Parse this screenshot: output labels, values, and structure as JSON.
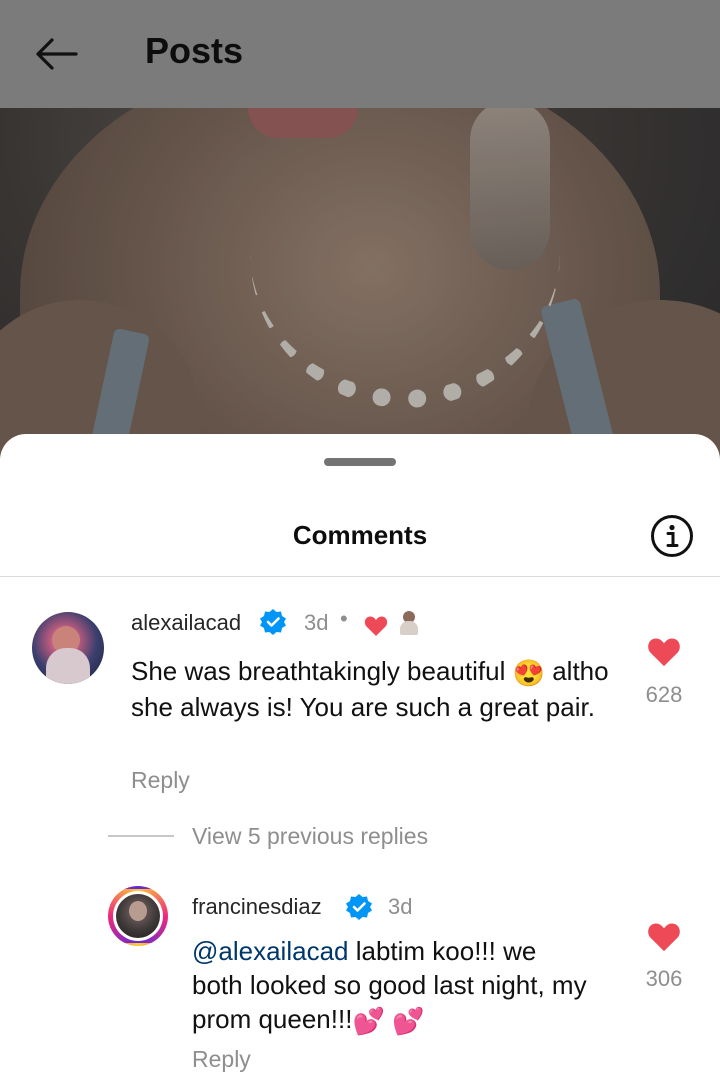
{
  "header": {
    "title": "Posts",
    "back_icon": "arrow-left-icon"
  },
  "sheet": {
    "title": "Comments",
    "info_icon": "info-icon"
  },
  "comments": [
    {
      "username": "alexailacad",
      "verified": true,
      "time": "3d",
      "text": "She was breathtakingly beautiful",
      "text_emoji": "😍",
      "text_rest": "altho she always is! You are such a great pair.",
      "reply_label": "Reply",
      "likes": "628",
      "liked": true,
      "author_liked": true
    }
  ],
  "view_replies_label": "View 5 previous replies",
  "replies": [
    {
      "username": "francinesdiaz",
      "verified": true,
      "time": "3d",
      "mention": "@alexailacad",
      "text": " labtim koo!!! we both looked so good last night, my prom queen!!!",
      "text_emoji": "💕 💕",
      "reply_label": "Reply",
      "likes": "306",
      "liked": true
    }
  ],
  "colors": {
    "like": "#ed4956",
    "verified": "#0095f6",
    "mention": "#00376b"
  }
}
